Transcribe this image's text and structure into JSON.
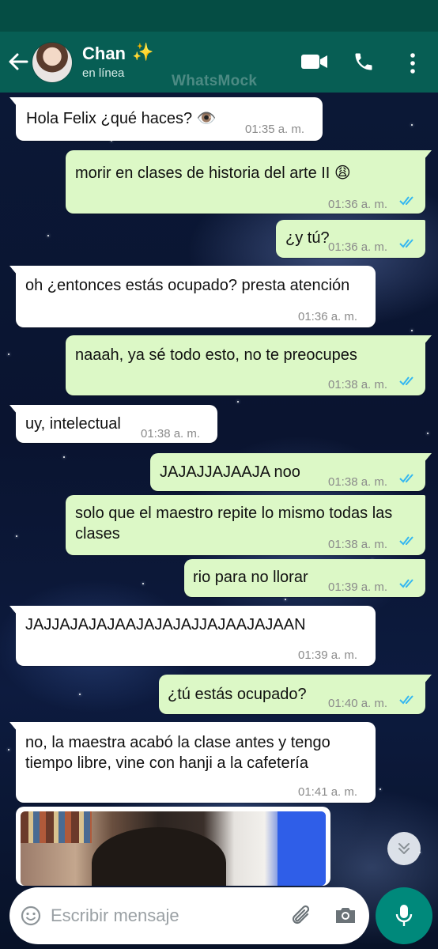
{
  "header": {
    "contact_name": "Chan",
    "contact_emoji": "✨",
    "presence": "en línea",
    "watermark": "WhatsMock"
  },
  "messages": [
    {
      "direction": "in",
      "text": "Hola Felix ¿qué haces? 👁️",
      "time": "01:35 a. m."
    },
    {
      "direction": "out",
      "text": "morir en clases de historia del arte II 😩",
      "time": "01:36 a. m.",
      "read": true
    },
    {
      "direction": "out",
      "text": "¿y tú?",
      "time": "01:36 a. m.",
      "read": true
    },
    {
      "direction": "in",
      "text": "oh ¿entonces estás ocupado? presta atención",
      "time": "01:36 a. m."
    },
    {
      "direction": "out",
      "text": "naaah, ya sé todo esto, no te preocupes",
      "time": "01:38 a. m.",
      "read": true
    },
    {
      "direction": "in",
      "text": "uy, intelectual",
      "time": "01:38 a. m."
    },
    {
      "direction": "out",
      "text": "JAJAJJAJAAJA noo",
      "time": "01:38 a. m.",
      "read": true
    },
    {
      "direction": "out",
      "text": "solo que el maestro repite lo mismo todas las clases",
      "time": "01:38 a. m.",
      "read": true
    },
    {
      "direction": "out",
      "text": "rio para no llorar",
      "time": "01:39 a. m.",
      "read": true
    },
    {
      "direction": "in",
      "text": "JAJJAJAJAJAAJAJAJAJJAJAAJAJAAN",
      "time": "01:39 a. m."
    },
    {
      "direction": "out",
      "text": "¿tú estás ocupado?",
      "time": "01:40 a. m.",
      "read": true
    },
    {
      "direction": "in",
      "text": "no, la maestra acabó la clase antes y tengo tiempo libre, vine con hanji a la cafetería",
      "time": "01:41 a. m."
    }
  ],
  "input": {
    "placeholder": "Escribir mensaje"
  },
  "colors": {
    "header": "#075e54",
    "status_bar": "#054d44",
    "outgoing_bubble": "#dcf8c6",
    "incoming_bubble": "#ffffff",
    "read_ticks": "#34b7f1",
    "mic_button": "#00897b"
  },
  "icons": {
    "back": "arrow-left-icon",
    "video": "video-call-icon",
    "phone": "phone-icon",
    "menu": "more-vert-icon",
    "emoji": "emoji-icon",
    "attach": "paperclip-icon",
    "camera": "camera-icon",
    "mic": "mic-icon",
    "scroll": "chevron-double-down-icon"
  }
}
